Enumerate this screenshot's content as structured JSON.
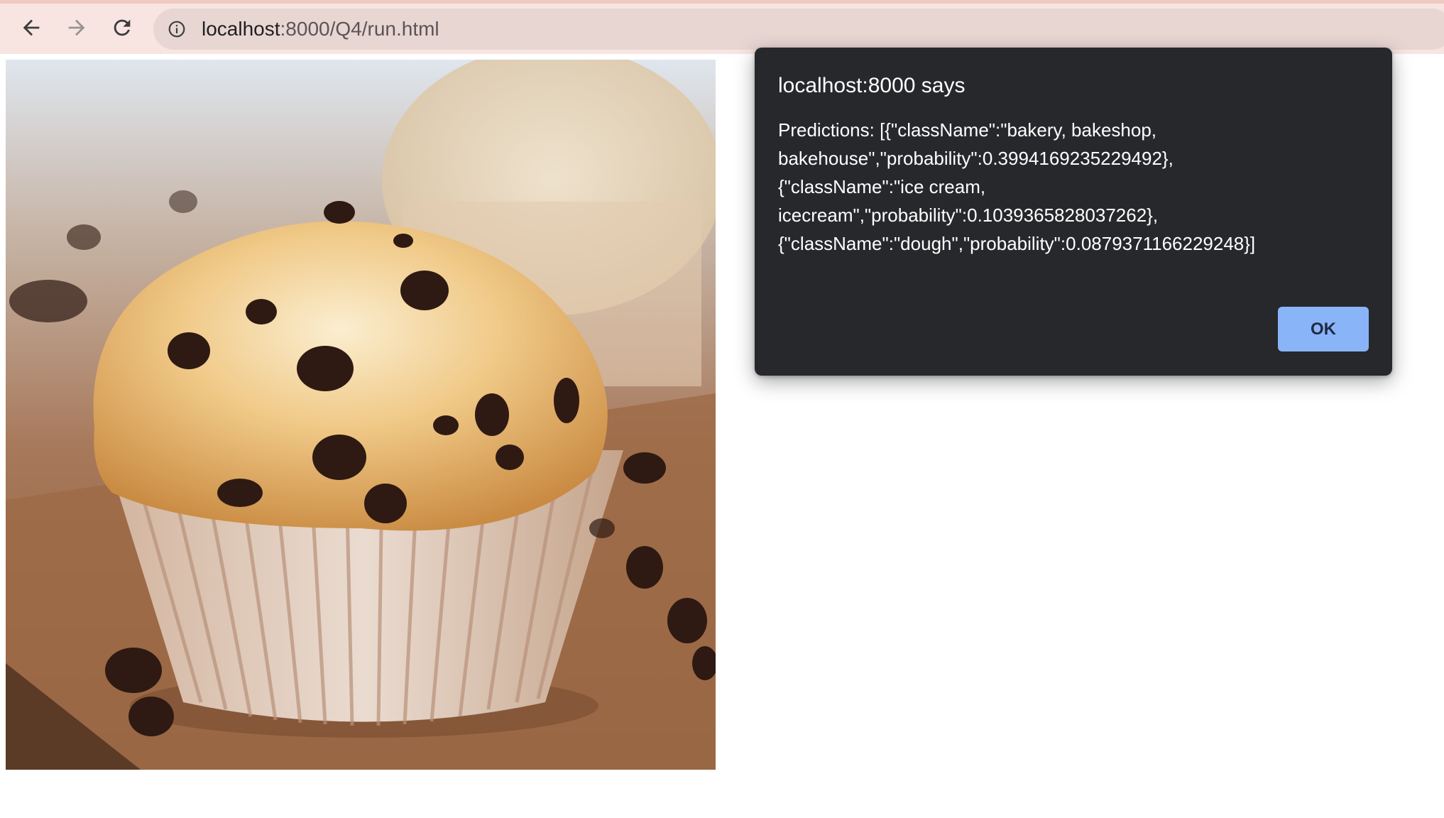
{
  "browser": {
    "url_host": "localhost",
    "url_path": ":8000/Q4/run.html",
    "icons": {
      "back": "arrow-left-icon",
      "forward": "arrow-right-icon",
      "reload": "reload-icon",
      "site_info": "info-icon"
    },
    "toolbar_color": "#f8e5e1",
    "omnibox_color": "#e8d6d3"
  },
  "content": {
    "image_subject": "chocolate chip muffin"
  },
  "alert": {
    "title": "localhost:8000 says",
    "message_lines": [
      "Predictions: [{\"className\":\"bakery, bakeshop,",
      "bakehouse\",\"probability\":0.3994169235229492},",
      "{\"className\":\"ice cream,",
      "icecream\",\"probability\":0.1039365828037262},",
      "{\"className\":\"dough\",\"probability\":0.0879371166229248}]"
    ],
    "ok_label": "OK",
    "background_color": "#27282b",
    "button_color": "#8ab4f8"
  }
}
